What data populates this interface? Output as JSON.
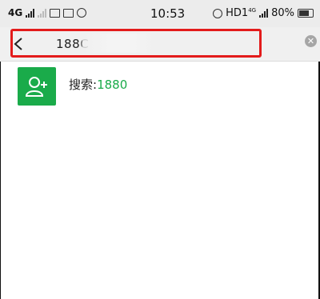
{
  "status_bar": {
    "network": "4G",
    "time": "10:53",
    "hd_label": "HD1",
    "hd_sup": "4G",
    "battery": "80%",
    "icons": [
      "signal-bars-icon",
      "signal-bars-dim-icon",
      "video-icon",
      "sim-icon",
      "app-badge-icon",
      "alarm-icon",
      "battery-icon"
    ]
  },
  "search": {
    "query": "188",
    "query_tail": "C",
    "clear_icon": "close-icon",
    "back_icon": "chevron-left-icon",
    "highlight_color": "#e31b1b"
  },
  "result": {
    "prefix": "搜索:",
    "query": "1880",
    "icon": "add-contact-icon",
    "accent_color": "#1aab4a"
  }
}
